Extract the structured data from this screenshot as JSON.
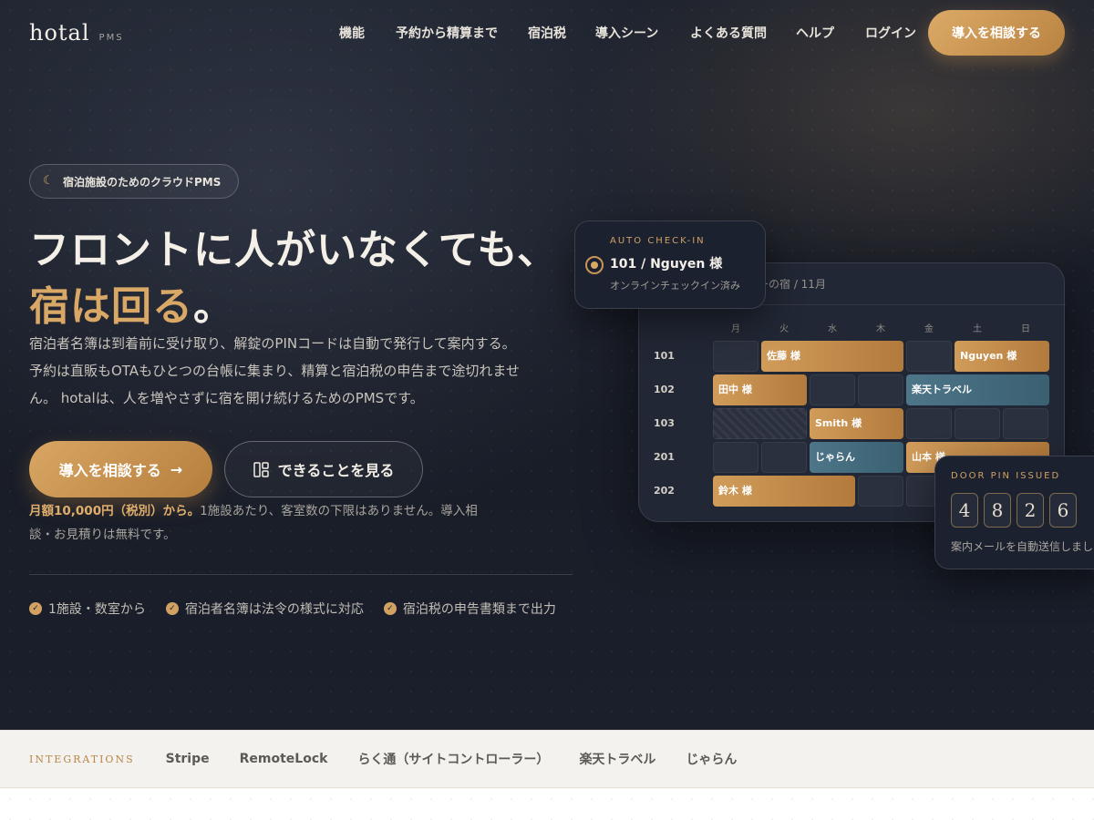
{
  "header": {
    "logo": "hotal",
    "logo_sub": "PMS",
    "nav": [
      "機能",
      "予約から精算まで",
      "宿泊税",
      "導入シーン",
      "よくある質問",
      "ヘルプ",
      "ログイン"
    ],
    "cta": "導入を相談する"
  },
  "hero": {
    "badge": "宿泊施設のためのクラウドPMS",
    "headline_line1": "フロントに人がいなくても、",
    "headline_line2_gold": "宿は回る",
    "headline_line2_end": "。",
    "description": "宿泊者名簿は到着前に受け取り、解錠のPINコードは自動で発行して案内する。 予約は直販もOTAもひとつの台帳に集まり、精算と宿泊税の申告まで途切れません。 hotalは、人を増やさずに宿を開け続けるためのPMSです。",
    "primary_button": "導入を相談する",
    "secondary_button": "できることを見る",
    "price": "月額10,000円（税別）から。",
    "price_note": "1施設あたり、客室数の下限はありません。導入相談・お見積りは無料です。",
    "features": [
      "1施設・数室から",
      "宿泊者名簿は法令の様式に対応",
      "宿泊税の申告書類まで出力"
    ]
  },
  "calendar": {
    "title": "ーの宿 / 11月",
    "days": [
      "月",
      "火",
      "水",
      "木",
      "金",
      "土",
      "日"
    ],
    "rooms": [
      "101",
      "102",
      "103",
      "201",
      "202"
    ],
    "bookings": {
      "b1": "佐藤 様",
      "b2": "Nguyen 様",
      "b3": "田中 様",
      "b4": "楽天トラベル",
      "b5": "Smith 様",
      "b6": "じゃらん",
      "b7": "山本 様",
      "b8": "鈴木 様"
    }
  },
  "checkin_card": {
    "label": "AUTO CHECK-IN",
    "room": "101 / Nguyen 様",
    "status": "オンラインチェックイン済み"
  },
  "pin_card": {
    "label": "DOOR PIN ISSUED",
    "digits": [
      "4",
      "8",
      "2",
      "6"
    ],
    "note": "案内メールを自動送信しました"
  },
  "integrations": {
    "label": "INTEGRATIONS",
    "items": [
      "Stripe",
      "RemoteLock",
      "らく通（サイトコントローラー）",
      "楽天トラベル",
      "じゃらん"
    ]
  },
  "colors": {
    "accent": "#d4a160",
    "hero_bg": "#1b1f29",
    "teal": "#446a7c"
  }
}
